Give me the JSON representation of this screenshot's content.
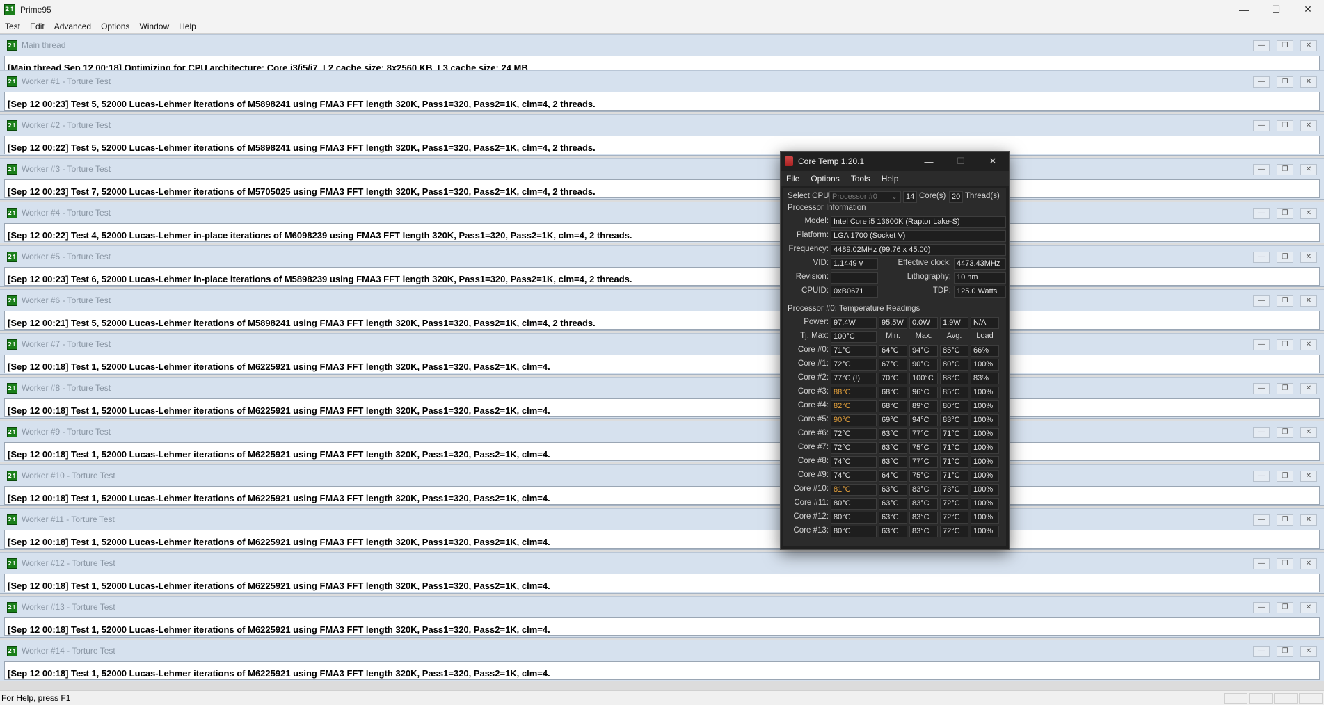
{
  "app": {
    "title": "Prime95",
    "icon_label": "2↑",
    "menu": [
      "Test",
      "Edit",
      "Advanced",
      "Options",
      "Window",
      "Help"
    ],
    "status": "For Help, press F1"
  },
  "main_thread": {
    "title": "Main thread",
    "line": "[Main thread Sep 12 00:18] Optimizing for CPU architecture: Core i3/i5/i7, L2 cache size: 8x2560 KB, L3 cache size: 24 MB"
  },
  "workers": [
    {
      "title": "Worker #1 - Torture Test",
      "line": "[Sep 12 00:23] Test 5, 52000 Lucas-Lehmer iterations of M5898241 using FMA3 FFT length 320K, Pass1=320, Pass2=1K, clm=4, 2 threads."
    },
    {
      "title": "Worker #2 - Torture Test",
      "line": "[Sep 12 00:22] Test 5, 52000 Lucas-Lehmer iterations of M5898241 using FMA3 FFT length 320K, Pass1=320, Pass2=1K, clm=4, 2 threads."
    },
    {
      "title": "Worker #3 - Torture Test",
      "line": "[Sep 12 00:23] Test 7, 52000 Lucas-Lehmer iterations of M5705025 using FMA3 FFT length 320K, Pass1=320, Pass2=1K, clm=4, 2 threads."
    },
    {
      "title": "Worker #4 - Torture Test",
      "line": "[Sep 12 00:22] Test 4, 52000 Lucas-Lehmer in-place iterations of M6098239 using FMA3 FFT length 320K, Pass1=320, Pass2=1K, clm=4, 2 threads."
    },
    {
      "title": "Worker #5 - Torture Test",
      "line": "[Sep 12 00:23] Test 6, 52000 Lucas-Lehmer in-place iterations of M5898239 using FMA3 FFT length 320K, Pass1=320, Pass2=1K, clm=4, 2 threads."
    },
    {
      "title": "Worker #6 - Torture Test",
      "line": "[Sep 12 00:21] Test 5, 52000 Lucas-Lehmer iterations of M5898241 using FMA3 FFT length 320K, Pass1=320, Pass2=1K, clm=4, 2 threads."
    },
    {
      "title": "Worker #7 - Torture Test",
      "line": "[Sep 12 00:18] Test 1, 52000 Lucas-Lehmer iterations of M6225921 using FMA3 FFT length 320K, Pass1=320, Pass2=1K, clm=4."
    },
    {
      "title": "Worker #8 - Torture Test",
      "line": "[Sep 12 00:18] Test 1, 52000 Lucas-Lehmer iterations of M6225921 using FMA3 FFT length 320K, Pass1=320, Pass2=1K, clm=4."
    },
    {
      "title": "Worker #9 - Torture Test",
      "line": "[Sep 12 00:18] Test 1, 52000 Lucas-Lehmer iterations of M6225921 using FMA3 FFT length 320K, Pass1=320, Pass2=1K, clm=4."
    },
    {
      "title": "Worker #10 - Torture Test",
      "line": "[Sep 12 00:18] Test 1, 52000 Lucas-Lehmer iterations of M6225921 using FMA3 FFT length 320K, Pass1=320, Pass2=1K, clm=4."
    },
    {
      "title": "Worker #11 - Torture Test",
      "line": "[Sep 12 00:18] Test 1, 52000 Lucas-Lehmer iterations of M6225921 using FMA3 FFT length 320K, Pass1=320, Pass2=1K, clm=4."
    },
    {
      "title": "Worker #12 - Torture Test",
      "line": "[Sep 12 00:18] Test 1, 52000 Lucas-Lehmer iterations of M6225921 using FMA3 FFT length 320K, Pass1=320, Pass2=1K, clm=4."
    },
    {
      "title": "Worker #13 - Torture Test",
      "line": "[Sep 12 00:18] Test 1, 52000 Lucas-Lehmer iterations of M6225921 using FMA3 FFT length 320K, Pass1=320, Pass2=1K, clm=4."
    },
    {
      "title": "Worker #14 - Torture Test",
      "line": "[Sep 12 00:18] Test 1, 52000 Lucas-Lehmer iterations of M6225921 using FMA3 FFT length 320K, Pass1=320, Pass2=1K, clm=4."
    }
  ],
  "coretemp": {
    "title": "Core Temp 1.20.1",
    "menu": [
      "File",
      "Options",
      "Tools",
      "Help"
    ],
    "select_cpu_label": "Select CPU:",
    "select_cpu_value": "Processor #0",
    "cores_value": "14",
    "cores_label": "Core(s)",
    "threads_value": "20",
    "threads_label": "Thread(s)",
    "proc_info_label": "Processor Information",
    "model_label": "Model:",
    "model": "Intel Core i5 13600K (Raptor Lake-S)",
    "platform_label": "Platform:",
    "platform": "LGA 1700 (Socket V)",
    "frequency_label": "Frequency:",
    "frequency": "4489.02MHz (99.76 x 45.00)",
    "vid_label": "VID:",
    "vid": "1.1449 v",
    "eff_clock_label": "Effective clock:",
    "eff_clock": "4473.43MHz",
    "revision_label": "Revision:",
    "revision": "",
    "lithography_label": "Lithography:",
    "lithography": "10 nm",
    "cpuid_label": "CPUID:",
    "cpuid": "0xB0671",
    "tdp_label": "TDP:",
    "tdp": "125.0 Watts",
    "temps_label": "Processor #0: Temperature Readings",
    "power_label": "Power:",
    "power": [
      "97.4W",
      "95.5W",
      "0.0W",
      "1.9W",
      "N/A"
    ],
    "tjmax_label": "Tj. Max:",
    "tjmax": "100°C",
    "col_headers": [
      "Min.",
      "Max.",
      "Avg.",
      "Load"
    ],
    "hot_color": "#e6a23c",
    "cores": [
      {
        "label": "Core #0:",
        "temp": "71°C",
        "min": "64°C",
        "max": "94°C",
        "avg": "85°C",
        "load": "66%",
        "hot": false
      },
      {
        "label": "Core #1:",
        "temp": "72°C",
        "min": "67°C",
        "max": "90°C",
        "avg": "80°C",
        "load": "100%",
        "hot": false
      },
      {
        "label": "Core #2:",
        "temp": "77°C (!)",
        "min": "70°C",
        "max": "100°C",
        "avg": "88°C",
        "load": "83%",
        "hot": false
      },
      {
        "label": "Core #3:",
        "temp": "88°C",
        "min": "68°C",
        "max": "96°C",
        "avg": "85°C",
        "load": "100%",
        "hot": true
      },
      {
        "label": "Core #4:",
        "temp": "82°C",
        "min": "68°C",
        "max": "89°C",
        "avg": "80°C",
        "load": "100%",
        "hot": true
      },
      {
        "label": "Core #5:",
        "temp": "90°C",
        "min": "69°C",
        "max": "94°C",
        "avg": "83°C",
        "load": "100%",
        "hot": true
      },
      {
        "label": "Core #6:",
        "temp": "72°C",
        "min": "63°C",
        "max": "77°C",
        "avg": "71°C",
        "load": "100%",
        "hot": false
      },
      {
        "label": "Core #7:",
        "temp": "72°C",
        "min": "63°C",
        "max": "75°C",
        "avg": "71°C",
        "load": "100%",
        "hot": false
      },
      {
        "label": "Core #8:",
        "temp": "74°C",
        "min": "63°C",
        "max": "77°C",
        "avg": "71°C",
        "load": "100%",
        "hot": false
      },
      {
        "label": "Core #9:",
        "temp": "74°C",
        "min": "64°C",
        "max": "75°C",
        "avg": "71°C",
        "load": "100%",
        "hot": false
      },
      {
        "label": "Core #10:",
        "temp": "81°C",
        "min": "63°C",
        "max": "83°C",
        "avg": "73°C",
        "load": "100%",
        "hot": true
      },
      {
        "label": "Core #11:",
        "temp": "80°C",
        "min": "63°C",
        "max": "83°C",
        "avg": "72°C",
        "load": "100%",
        "hot": false
      },
      {
        "label": "Core #12:",
        "temp": "80°C",
        "min": "63°C",
        "max": "83°C",
        "avg": "72°C",
        "load": "100%",
        "hot": false
      },
      {
        "label": "Core #13:",
        "temp": "80°C",
        "min": "63°C",
        "max": "83°C",
        "avg": "72°C",
        "load": "100%",
        "hot": false
      }
    ]
  }
}
